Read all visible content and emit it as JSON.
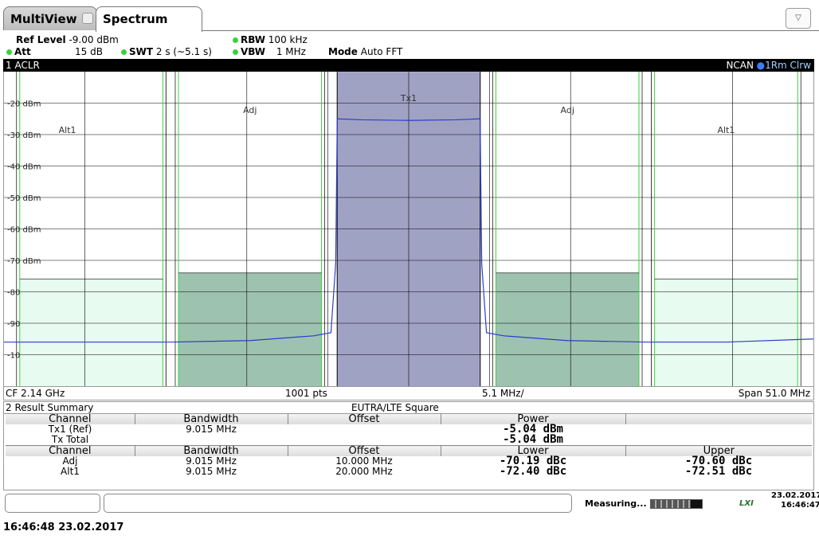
{
  "tabs": {
    "multiview": "MultiView",
    "spectrum": "Spectrum"
  },
  "settings": {
    "ref_level_label": "Ref Level",
    "ref_level_value": "-9.00 dBm",
    "att_label": "Att",
    "att_value": "15 dB",
    "swt_label": "SWT",
    "swt_value": "2 s (~5.1 s)",
    "rbw_label": "RBW",
    "rbw_value": "100 kHz",
    "vbw_label": "VBW",
    "vbw_value": "1 MHz",
    "mode_label": "Mode",
    "mode_value": "Auto FFT"
  },
  "panel": {
    "title": "1 ACLR",
    "ncan": "NCAN",
    "trace": "1Rm Clrw"
  },
  "colors": {
    "accent_green": "#3bd13b",
    "trace_blue": "#2a3dcc",
    "tx_fill": "#a0a2c4",
    "adj_fill": "#9ec2b0",
    "alt_fill": "#e8fbf1"
  },
  "chart_data": {
    "type": "line",
    "y_ticks": [
      "-20 dBm",
      "-30 dBm",
      "-40 dBm",
      "-50 dBm",
      "-60 dBm",
      "-70 dBm",
      "-80",
      "-90",
      "-10"
    ],
    "channel_labels": [
      "Alt1",
      "Adj",
      "Tx1",
      "Adj",
      "Alt1"
    ],
    "xlim": [
      -25.5,
      25.5
    ],
    "ylim": [
      -109,
      -9
    ],
    "channels": [
      {
        "label": "Alt1",
        "center": -20.0,
        "width": 9.015,
        "limit": -75
      },
      {
        "label": "Adj",
        "center": -10.0,
        "width": 9.015,
        "limit": -73
      },
      {
        "label": "Tx1",
        "center": 0.0,
        "width": 9.015,
        "limit": -9
      },
      {
        "label": "Adj",
        "center": 10.0,
        "width": 9.015,
        "limit": -73
      },
      {
        "label": "Alt1",
        "center": 20.0,
        "width": 9.015,
        "limit": -75
      }
    ],
    "trace": {
      "x": [
        -25.5,
        -20,
        -15,
        -10,
        -6,
        -4.9,
        -4.6,
        -4.5,
        -3,
        0,
        3,
        4.5,
        4.6,
        4.9,
        6,
        10,
        15,
        20,
        25.5
      ],
      "y": [
        -95,
        -95,
        -95,
        -94.5,
        -93,
        -92,
        -70,
        -24,
        -24.3,
        -24.5,
        -24.3,
        -24,
        -70,
        -92,
        -93,
        -94.5,
        -95,
        -95,
        -94
      ]
    }
  },
  "footer": {
    "cf": "CF 2.14 GHz",
    "pts": "1001 pts",
    "div": "5.1 MHz/",
    "span": "Span 51.0 MHz"
  },
  "result": {
    "title": "2 Result Summary",
    "standard": "EUTRA/LTE Square",
    "h1": [
      "Channel",
      "Bandwidth",
      "Offset",
      "Power",
      ""
    ],
    "r1": {
      "ch": "Tx1 (Ref)",
      "bw": "9.015 MHz",
      "pw": "-5.04 dBm"
    },
    "r2": {
      "ch": "Tx Total",
      "pw": "-5.04 dBm"
    },
    "h2": [
      "Channel",
      "Bandwidth",
      "Offset",
      "Lower",
      "Upper"
    ],
    "r3": {
      "ch": "Adj",
      "bw": "9.015 MHz",
      "off": "10.000 MHz",
      "lo": "-70.19 dBc",
      "up": "-70.60 dBc"
    },
    "r4": {
      "ch": "Alt1",
      "bw": "9.015 MHz",
      "off": "20.000 MHz",
      "lo": "-72.40 dBc",
      "up": "-72.51 dBc"
    }
  },
  "status": {
    "measuring": "Measuring...",
    "lxi": "LXI",
    "date": "23.02.2017",
    "time": "16:46:47"
  },
  "bottom_timestamp": "16:46:48 23.02.2017"
}
